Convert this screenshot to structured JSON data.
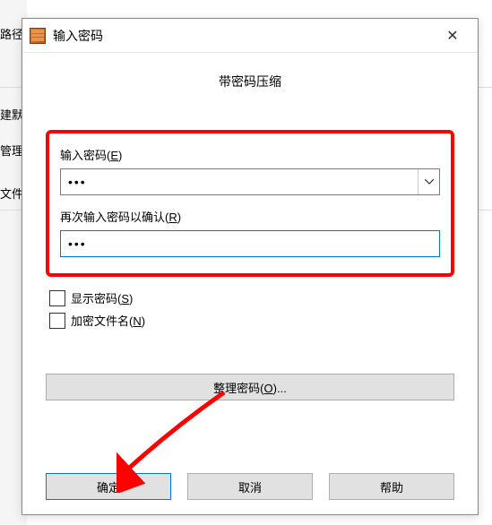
{
  "background": {
    "text1": "路径",
    "sidebar_items": [
      "建默",
      "管理",
      "文件"
    ]
  },
  "dialog": {
    "title": "输入密码",
    "close_glyph": "✕",
    "section_title": "带密码压缩",
    "password_label_pre": "输入密码(",
    "password_label_key": "E",
    "password_label_post": ")",
    "password_value": "•••",
    "confirm_label_pre": "再次输入密码以确认(",
    "confirm_label_key": "R",
    "confirm_label_post": ")",
    "confirm_value": "•••",
    "show_pw_pre": "显示密码(",
    "show_pw_key": "S",
    "show_pw_post": ")",
    "encrypt_names_pre": "加密文件名(",
    "encrypt_names_key": "N",
    "encrypt_names_post": ")",
    "organize_pre": "整理密码(",
    "organize_key": "O",
    "organize_post": ")...",
    "ok": "确定",
    "cancel": "取消",
    "help": "帮助"
  }
}
